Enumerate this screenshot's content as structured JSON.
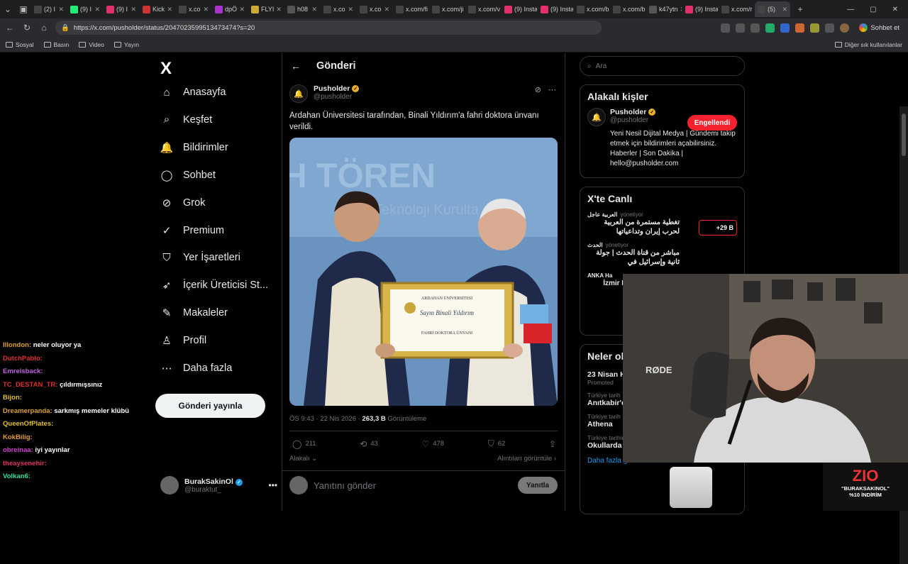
{
  "browser": {
    "tabs": [
      {
        "label": "(2) I",
        "color": "#444"
      },
      {
        "label": "(9) I",
        "color": "#2e7"
      },
      {
        "label": "(9) I",
        "color": "#e1306c"
      },
      {
        "label": "Kick",
        "color": "#c33"
      },
      {
        "label": "x.co",
        "color": "#444"
      },
      {
        "label": "dpÖ",
        "color": "#a3c"
      },
      {
        "label": "FLYI",
        "color": "#ca3"
      },
      {
        "label": "h08",
        "color": "#555"
      },
      {
        "label": "x.co",
        "color": "#444"
      },
      {
        "label": "x.co",
        "color": "#444"
      },
      {
        "label": "x.com/fi",
        "color": "#444"
      },
      {
        "label": "x.com/ji",
        "color": "#444"
      },
      {
        "label": "x.com/v",
        "color": "#444"
      },
      {
        "label": "(9) Insta",
        "color": "#e1306c"
      },
      {
        "label": "(9) Insta",
        "color": "#e1306c"
      },
      {
        "label": "x.com/b",
        "color": "#444"
      },
      {
        "label": "x.com/b",
        "color": "#444"
      },
      {
        "label": "k47ytn",
        "color": "#555"
      },
      {
        "label": "(9) Insta",
        "color": "#e1306c"
      },
      {
        "label": "x.com/r",
        "color": "#444"
      },
      {
        "label": "(5)",
        "color": "#444"
      }
    ],
    "url": "https://x.com/pusholder/status/2047023599513473474?s=20",
    "copilot_label": "Sohbet et",
    "bookmarks": [
      "Sosyal",
      "Basın",
      "Video",
      "Yayın"
    ],
    "bookmarks_right": "Diğer sık kullanılanlar"
  },
  "nav": {
    "logo": "X",
    "items": [
      {
        "label": "Anasayfa",
        "icon": "⌂"
      },
      {
        "label": "Keşfet",
        "icon": "⌕"
      },
      {
        "label": "Bildirimler",
        "icon": "🔔"
      },
      {
        "label": "Sohbet",
        "icon": "◯"
      },
      {
        "label": "Grok",
        "icon": "⊘"
      },
      {
        "label": "Premium",
        "icon": "✓"
      },
      {
        "label": "Yer İşaretleri",
        "icon": "⛉"
      },
      {
        "label": "İçerik Üreticisi St...",
        "icon": "➶"
      },
      {
        "label": "Makaleler",
        "icon": "✎"
      },
      {
        "label": "Profil",
        "icon": "♙"
      },
      {
        "label": "Daha fazla",
        "icon": "⋯"
      }
    ],
    "post_button": "Gönderi yayınla",
    "account": {
      "name": "BurakSakinOl",
      "handle": "@buraktut_"
    }
  },
  "chat": [
    {
      "user": "Illondon:",
      "msg": "neler oluyor ya",
      "color": "#e0a030"
    },
    {
      "user": "DutchPablo:",
      "msg": "",
      "color": "#e03030"
    },
    {
      "user": "Emreisback:",
      "msg": "",
      "color": "#c060e0"
    },
    {
      "user": "TC_DESTAN_TR:",
      "msg": "çıldırmışsınız",
      "color": "#e03030"
    },
    {
      "user": "Bijon:",
      "msg": "",
      "color": "#e0c030"
    },
    {
      "user": "Dreamerpanda:",
      "msg": "sarkmış memeler klübü",
      "color": "#e0a030"
    },
    {
      "user": "QueenOfPlates:",
      "msg": "",
      "color": "#e0c030"
    },
    {
      "user": "KokBilig:",
      "msg": "",
      "color": "#e0a030"
    },
    {
      "user": "obreinaa:",
      "msg": "iyi yayınlar",
      "color": "#d040d0"
    },
    {
      "user": "theaysenehir:",
      "msg": "",
      "color": "#e03060"
    },
    {
      "user": "Volkan6:",
      "msg": "",
      "color": "#30e0a0"
    }
  ],
  "post": {
    "header_title": "Gönderi",
    "author_name": "Pusholder",
    "author_handle": "@pusholder",
    "text": "Ardahan Üniversitesi tarafından, Binali Yıldırım'a fahri doktora ünvanı verildi.",
    "time": "ÖS 9:43 · 22 Nis 2026 · ",
    "views": "263,3 B",
    "views_label": "Görüntüleme",
    "replies": "211",
    "reposts": "43",
    "likes": "478",
    "bookmarks": "62",
    "related_label": "Alakalı",
    "quotes_label": "Alıntıları görüntüle",
    "reply_placeholder": "Yanıtını gönder",
    "reply_button": "Yanıtla",
    "photo_banner": "H TÖREN",
    "photo_banner_sub": "Teknoloji Kurulta",
    "certificate_title": "ARDAHAN ÜNİVERSİTESİ",
    "certificate_name": "Sayın Binali Yıldırım",
    "certificate_sub": "FAHRİ DOKTORA ÜNVANI"
  },
  "right": {
    "search_placeholder": "Ara",
    "relevant_title": "Alakalı kişler",
    "relevant": {
      "name": "Pusholder",
      "handle": "@pusholder",
      "button": "Engellendi",
      "bio": "Yeni Nesil Dijital Medya | Gündemi takip etmek için bildirimleri açabilirsiniz. Haberler | Son Dakika | hello@pusholder.com"
    },
    "live_title": "X'te Canlı",
    "live": [
      {
        "source": "العربية عاجل",
        "role": "yönetiyor",
        "title": "تغطية مستمرة من العربية لحرب إيران وتداعياتها",
        "count": "+29 B"
      },
      {
        "source": "الحدث",
        "role": "yönetiyor",
        "title": "مباشر من قناة الحدث | جولة ثانية وإسرائيل في",
        "count": ""
      },
      {
        "source": "ANKA Ha",
        "role": "",
        "title": "İzmir Büyü Başkanı Ce",
        "count": ""
      }
    ],
    "trends_title": "Neler ol",
    "trends": [
      {
        "sub": "",
        "title": "23 Nisan H",
        "promo": "Promoted"
      },
      {
        "sub": "Türkiye tarih",
        "title": "Anıtkabir'd",
        "promo": ""
      },
      {
        "sub": "Türkiye tarih",
        "title": "Athena",
        "promo": ""
      },
      {
        "sub": "Türkiye tarihinde gündemde",
        "title": "Okullarda 7",
        "promo": ""
      }
    ],
    "show_more": "Daha fazla göster"
  },
  "overlay": {
    "mic_brand": "RØDE",
    "sponsor_logo": "ZIO",
    "sponsor_code": "\"BURAKSAKINOL\"",
    "sponsor_discount": "%10 İNDİRİM"
  },
  "colors": {
    "accent": "#1d9bf0",
    "blocked": "#f4212e",
    "verified": "#e8b02a"
  }
}
